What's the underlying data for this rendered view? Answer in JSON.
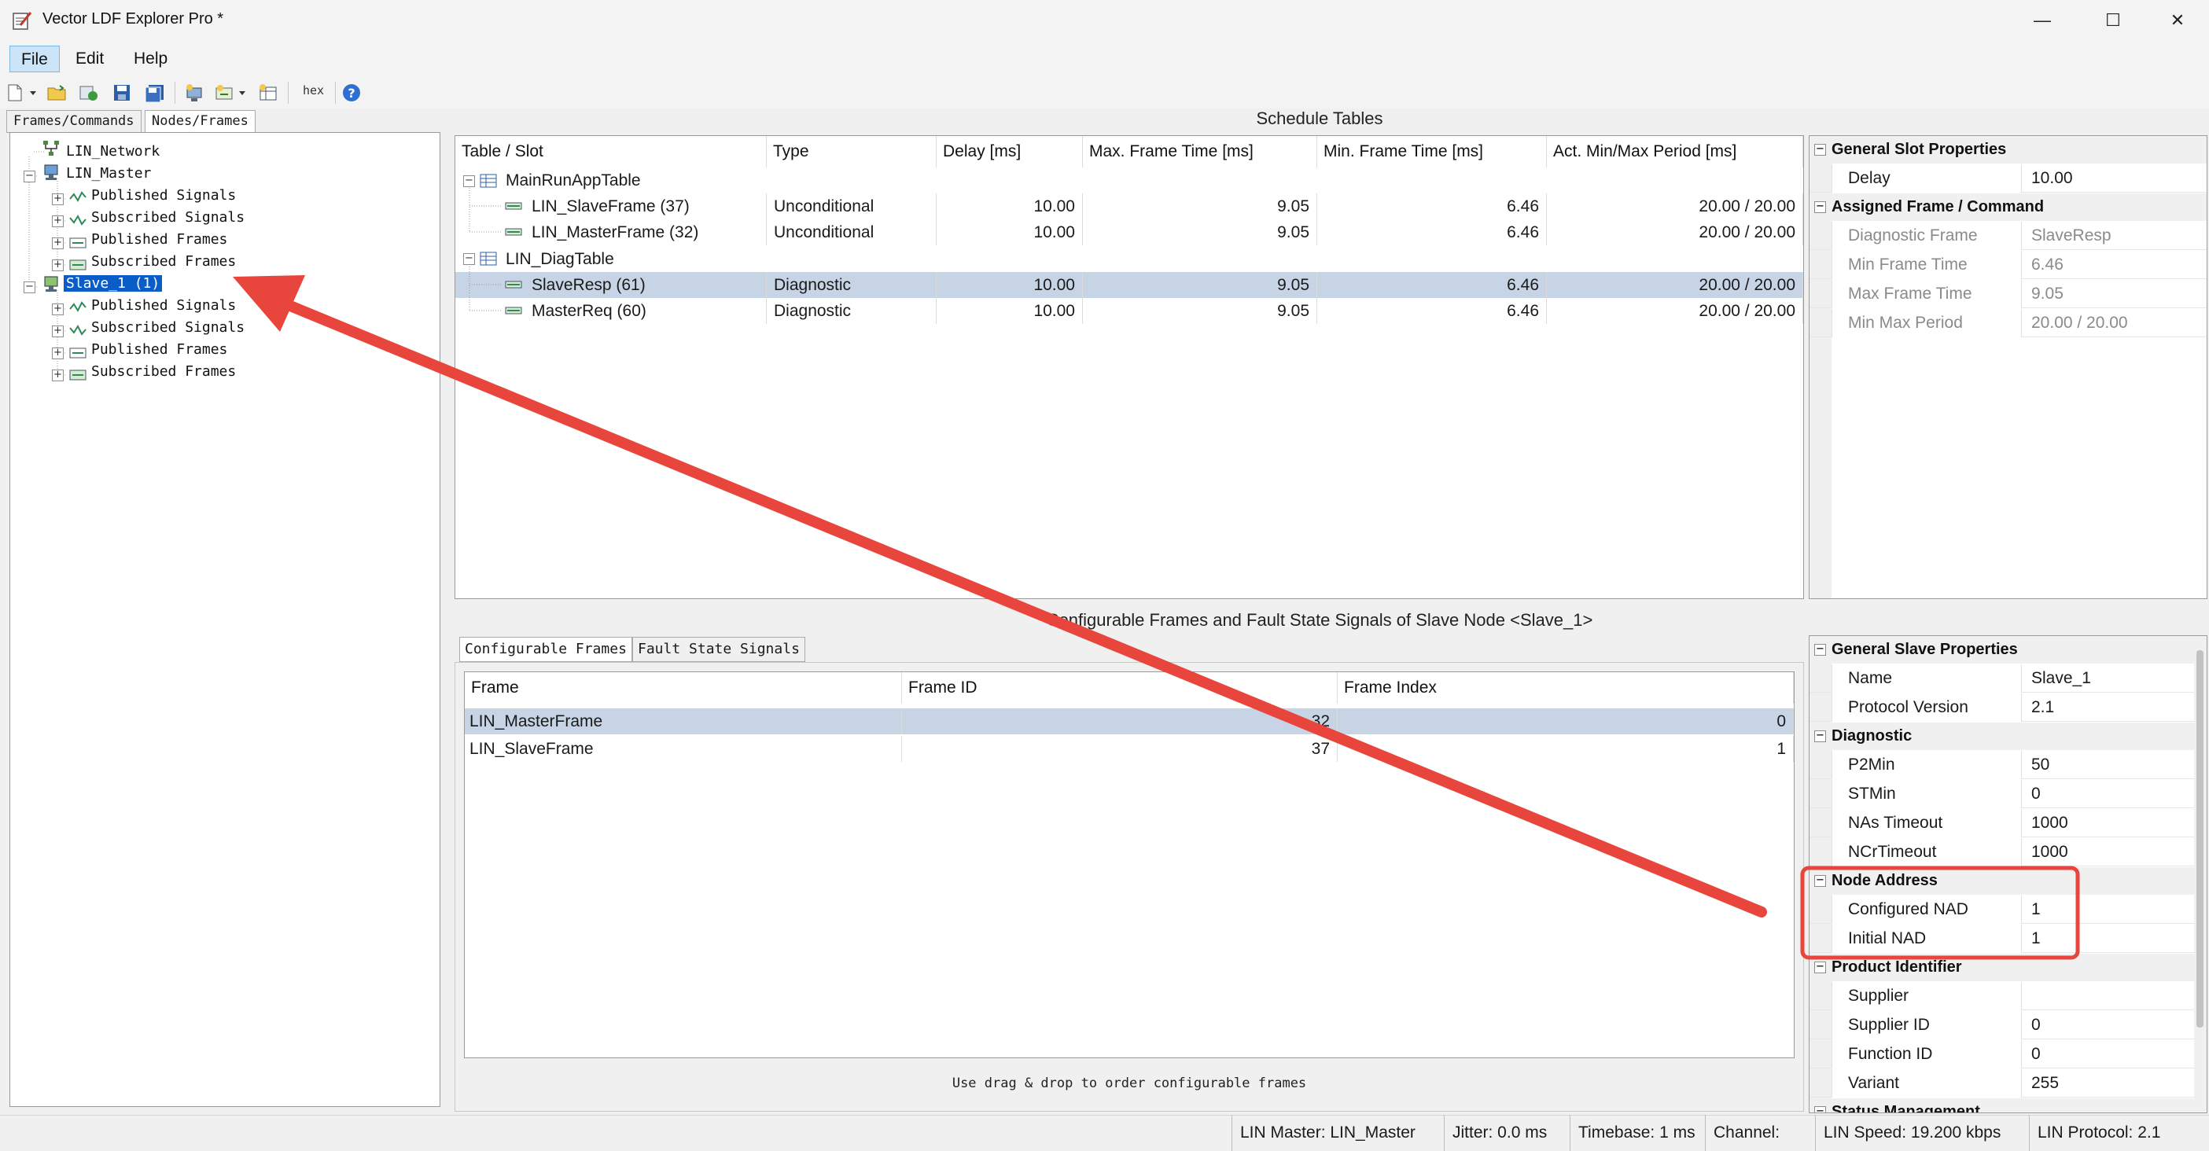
{
  "window": {
    "title": "Vector LDF Explorer Pro *",
    "minimize": "—",
    "maximize": "☐",
    "close": "✕"
  },
  "menu": {
    "file": "File",
    "edit": "Edit",
    "help": "Help"
  },
  "toolbar": {
    "hex_label": "hex"
  },
  "left_tabs": {
    "frames": "Frames/Commands",
    "nodes": "Nodes/Frames"
  },
  "tree": {
    "network": "LIN_Network",
    "master": "LIN_Master",
    "master_children": [
      "Published Signals",
      "Subscribed Signals",
      "Published Frames",
      "Subscribed Frames"
    ],
    "slave": "Slave_1 (1)",
    "slave_children": [
      "Published Signals",
      "Subscribed Signals",
      "Published Frames",
      "Subscribed Frames"
    ]
  },
  "schedule": {
    "heading": "Schedule Tables",
    "columns": [
      "Table / Slot",
      "Type",
      "Delay [ms]",
      "Max. Frame Time [ms]",
      "Min. Frame Time [ms]",
      "Act. Min/Max Period [ms]"
    ],
    "table1": "MainRunAppTable",
    "table1_rows": [
      {
        "slot": "LIN_SlaveFrame (37)",
        "type": "Unconditional",
        "delay": "10.00",
        "max": "9.05",
        "min": "6.46",
        "period": "20.00 / 20.00"
      },
      {
        "slot": "LIN_MasterFrame (32)",
        "type": "Unconditional",
        "delay": "10.00",
        "max": "9.05",
        "min": "6.46",
        "period": "20.00 / 20.00"
      }
    ],
    "table2": "LIN_DiagTable",
    "table2_rows": [
      {
        "slot": "SlaveResp (61)",
        "type": "Diagnostic",
        "delay": "10.00",
        "max": "9.05",
        "min": "6.46",
        "period": "20.00 / 20.00"
      },
      {
        "slot": "MasterReq (60)",
        "type": "Diagnostic",
        "delay": "10.00",
        "max": "9.05",
        "min": "6.46",
        "period": "20.00 / 20.00"
      }
    ]
  },
  "slot_props": {
    "cat1": "General Slot Properties",
    "delay_name": "Delay",
    "delay_value": "10.00",
    "cat2": "Assigned Frame / Command",
    "rows": [
      {
        "name": "Diagnostic Frame",
        "value": "SlaveResp"
      },
      {
        "name": "Min Frame Time",
        "value": "6.46"
      },
      {
        "name": "Max Frame Time",
        "value": "9.05"
      },
      {
        "name": "Min Max Period",
        "value": "20.00 / 20.00"
      }
    ]
  },
  "configurable": {
    "heading": "Configurable Frames and Fault State Signals of Slave Node <Slave_1>",
    "tab_frames": "Configurable Frames",
    "tab_fault": "Fault State Signals",
    "columns": [
      "Frame",
      "Frame ID",
      "Frame Index"
    ],
    "rows": [
      {
        "frame": "LIN_MasterFrame",
        "id": "32",
        "index": "0"
      },
      {
        "frame": "LIN_SlaveFrame",
        "id": "37",
        "index": "1"
      }
    ],
    "hint": "Use drag & drop to order configurable frames"
  },
  "slave_props": {
    "cat_general": "General Slave Properties",
    "name_name": "Name",
    "name_value": "Slave_1",
    "proto_name": "Protocol Version",
    "proto_value": "2.1",
    "cat_diag": "Diagnostic",
    "diag_rows": [
      {
        "name": "P2Min",
        "value": "50"
      },
      {
        "name": "STMin",
        "value": "0"
      },
      {
        "name": "NAs Timeout",
        "value": "1000"
      },
      {
        "name": "NCrTimeout",
        "value": "1000"
      }
    ],
    "cat_nad": "Node Address",
    "nad_rows": [
      {
        "name": "Configured NAD",
        "value": "1"
      },
      {
        "name": "Initial NAD",
        "value": "1"
      }
    ],
    "cat_product": "Product Identifier",
    "product_rows": [
      {
        "name": "Supplier",
        "value": ""
      },
      {
        "name": "Supplier ID",
        "value": "0"
      },
      {
        "name": "Function ID",
        "value": "0"
      },
      {
        "name": "Variant",
        "value": "255"
      }
    ],
    "cat_status": "Status Management"
  },
  "status": {
    "master": "LIN Master: LIN_Master",
    "jitter": "Jitter: 0.0 ms",
    "timebase": "Timebase: 1 ms",
    "channel": "Channel:",
    "speed": "LIN Speed: 19.200 kbps",
    "protocol": "LIN Protocol: 2.1"
  },
  "colors": {
    "annotation": "#e8453c",
    "selection": "#0a5cc8",
    "row_selected": "#c6d4e6"
  }
}
